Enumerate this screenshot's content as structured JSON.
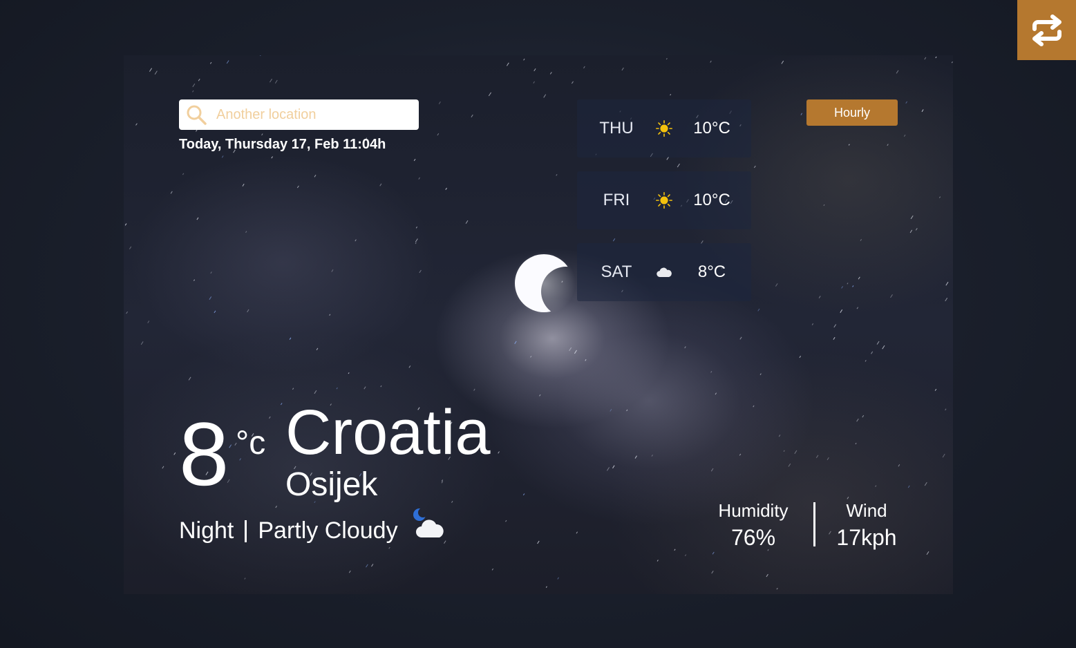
{
  "search": {
    "placeholder": "Another location",
    "value": ""
  },
  "date_text": "Today, Thursday 17, Feb 11:04h",
  "forecast": [
    {
      "day": "THU",
      "icon": "sun-icon",
      "temp": "10°C"
    },
    {
      "day": "FRI",
      "icon": "sun-icon",
      "temp": "10°C"
    },
    {
      "day": "SAT",
      "icon": "cloud-icon",
      "temp": "8°C"
    }
  ],
  "hourly_label": "Hourly",
  "current": {
    "temp": "8",
    "unit": "°c",
    "country": "Croatia",
    "city": "Osijek",
    "period": "Night",
    "condition": "Partly Cloudy",
    "condition_icon": "moon-cloud-icon"
  },
  "stats": {
    "humidity_label": "Humidity",
    "humidity_value": "76%",
    "wind_label": "Wind",
    "wind_value": "17kph"
  },
  "colors": {
    "accent": "#b5782f",
    "placeholder": "#f1cf9d",
    "sun": "#f4c20d",
    "moon_icon": "#2f6fd6"
  }
}
